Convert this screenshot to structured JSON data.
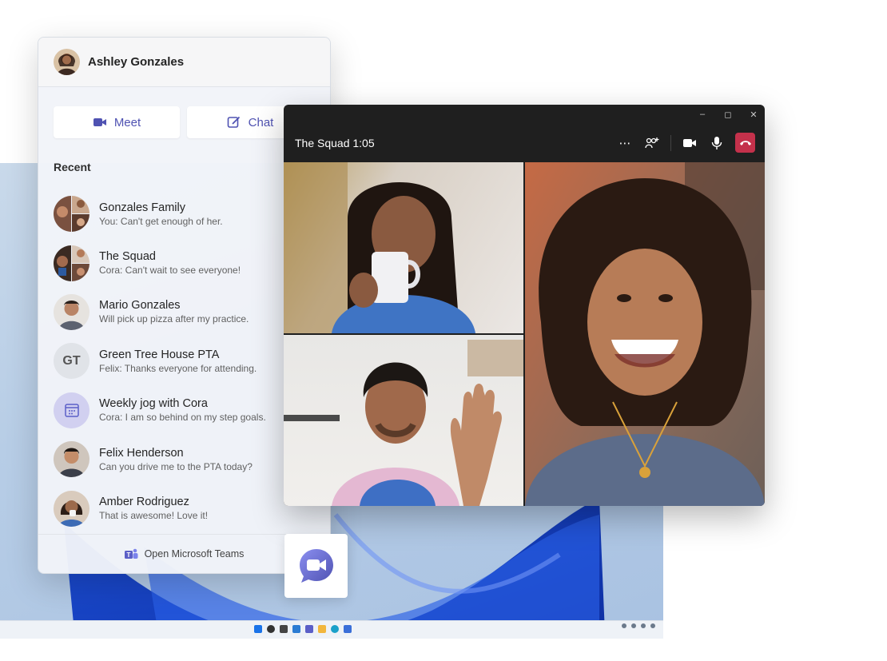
{
  "flyout": {
    "user_name": "Ashley Gonzales",
    "actions": {
      "meet_label": "Meet",
      "chat_label": "Chat"
    },
    "recent_label": "Recent",
    "chats": [
      {
        "name": "Gonzales Family",
        "preview": "You: Can't get enough of her."
      },
      {
        "name": "The Squad",
        "preview": "Cora: Can't wait to see everyone!"
      },
      {
        "name": "Mario Gonzales",
        "preview": "Will pick up pizza after my practice."
      },
      {
        "name": "Green Tree House PTA",
        "preview": "Felix: Thanks everyone for attending.",
        "initials": "GT"
      },
      {
        "name": "Weekly jog with Cora",
        "preview": "Cora: I am so behind on my step goals."
      },
      {
        "name": "Felix Henderson",
        "preview": "Can you drive me to the PTA today?"
      },
      {
        "name": "Amber Rodriguez",
        "preview": "That is awesome! Love it!"
      }
    ],
    "footer_label": "Open Microsoft Teams"
  },
  "call": {
    "title": "The Squad 1:05",
    "tools": [
      "more-icon",
      "people-add-icon",
      "video-icon",
      "mic-icon",
      "hangup-icon"
    ]
  },
  "colors": {
    "teams_purple": "#4f52b2",
    "hangup_red": "#c4314b",
    "call_bg": "#1f1f1f"
  }
}
